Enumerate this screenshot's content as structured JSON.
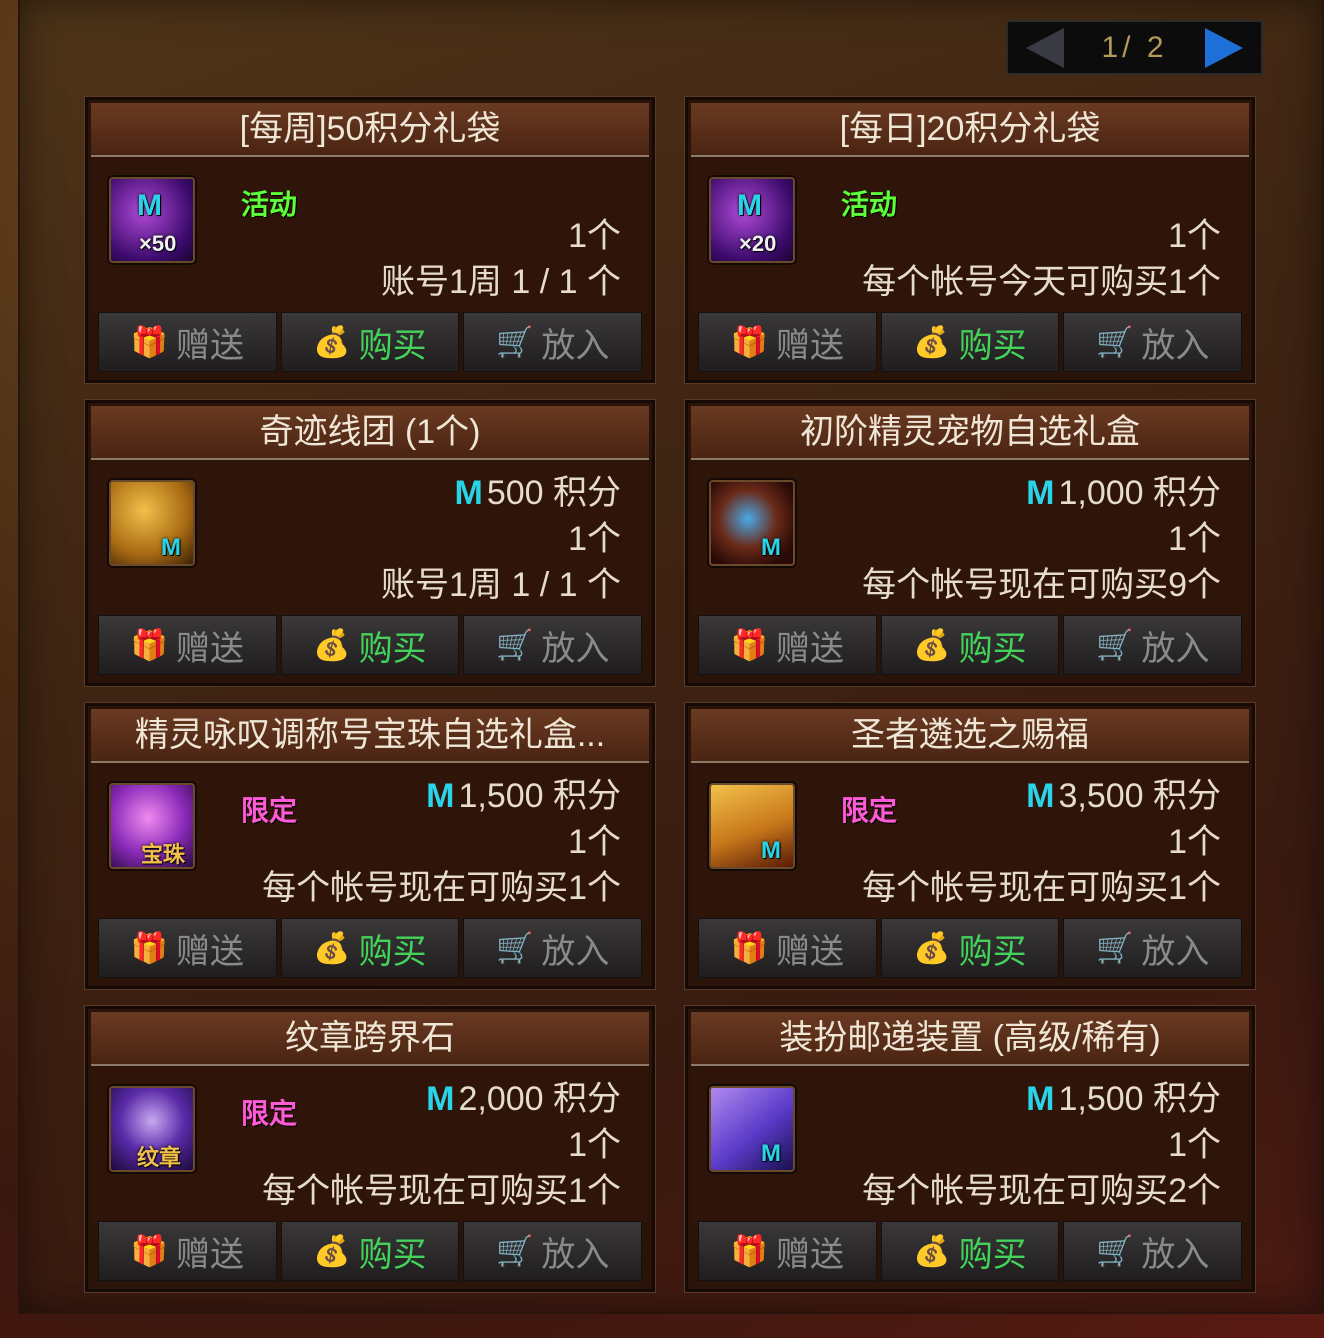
{
  "pager": {
    "current": "1",
    "total": "2",
    "text": "1/ 2"
  },
  "buttons": {
    "gift": "赠送",
    "buy": "购买",
    "cart": "放入"
  },
  "items": [
    {
      "title": "[每周]50积分礼袋",
      "badge": "活动",
      "badge_color": "#5cff3a",
      "price": "",
      "qty": "1个",
      "limit": "账号1周 1 / 1 个",
      "icon": "m-coin-bag-x50-icon",
      "icon_tag": "×50"
    },
    {
      "title": "[每日]20积分礼袋",
      "badge": "活动",
      "badge_color": "#5cff3a",
      "price": "",
      "qty": "1个",
      "limit": "每个帐号今天可购买1个",
      "icon": "m-coin-bag-x20-icon",
      "icon_tag": "×20"
    },
    {
      "title": "奇迹线团 (1个)",
      "badge": "",
      "price": "500 积分",
      "qty": "1个",
      "limit": "账号1周 1 / 1 个",
      "icon": "yarn-ball-icon",
      "icon_tag": "M"
    },
    {
      "title": "初阶精灵宠物自选礼盒",
      "badge": "",
      "price": "1,000 积分",
      "qty": "1个",
      "limit": "每个帐号现在可购买9个",
      "icon": "pet-box-icon",
      "icon_tag": "M"
    },
    {
      "title": "精灵咏叹调称号宝珠自选礼盒...",
      "badge": "限定",
      "badge_color": "#ff5ad8",
      "price": "1,500 积分",
      "qty": "1个",
      "limit": "每个帐号现在可购买1个",
      "icon": "orb-icon",
      "icon_tag": "宝珠"
    },
    {
      "title": "圣者遴选之赐福",
      "badge": "限定",
      "badge_color": "#ff5ad8",
      "price": "3,500 积分",
      "qty": "1个",
      "limit": "每个帐号现在可购买1个",
      "icon": "golden-scroll-icon",
      "icon_tag": "M"
    },
    {
      "title": "纹章跨界石",
      "badge": "限定",
      "badge_color": "#ff5ad8",
      "price": "2,000 积分",
      "qty": "1个",
      "limit": "每个帐号现在可购买1个",
      "icon": "emblem-stone-icon",
      "icon_tag": "纹章"
    },
    {
      "title": "装扮邮递装置 (高级/稀有)",
      "badge": "",
      "price": "1,500 积分",
      "qty": "1个",
      "limit": "每个帐号现在可购买2个",
      "icon": "mail-device-icon",
      "icon_tag": "M"
    }
  ],
  "colors": {
    "m_coin": "#2ad4e8",
    "buy_green": "#43d25a"
  }
}
